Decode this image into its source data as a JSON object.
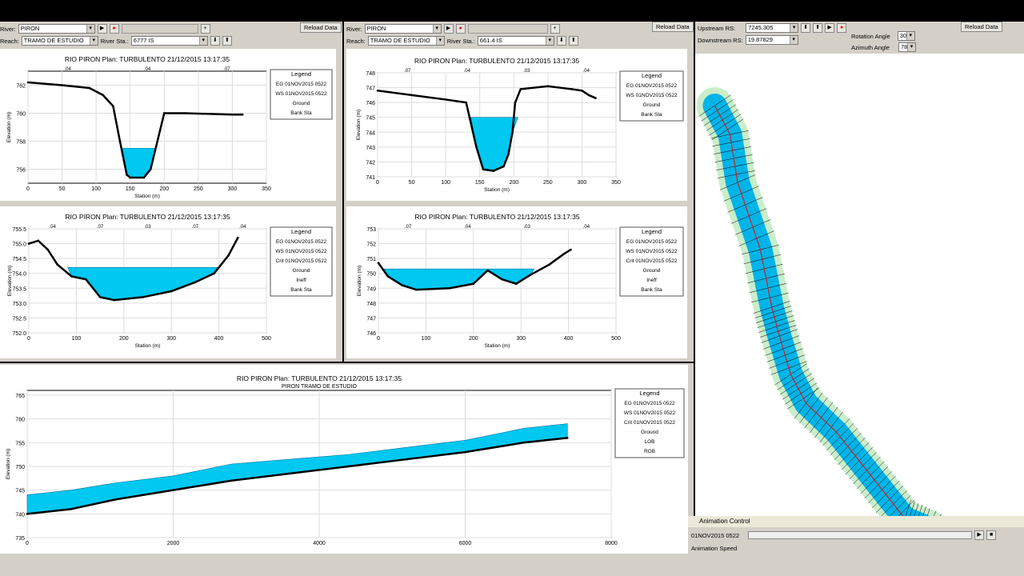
{
  "panel_left": {
    "river_label": "River:",
    "river": "PIRON",
    "reach_label": "Reach:",
    "reach": "TRAMO DE ESTUDIO",
    "rs_label": "River Sta.:",
    "rs": "6777  IS",
    "reload": "Reload Data"
  },
  "panel_mid": {
    "river_label": "River:",
    "river": "PIRON",
    "reach_label": "Reach:",
    "reach": "TRAMO DE ESTUDIO",
    "rs_label": "River Sta.:",
    "rs": "661.4  IS",
    "reload": "Reload Data"
  },
  "panel_right": {
    "up_label": "Upstream RS:",
    "up": "7245.305",
    "down_label": "Downstream RS:",
    "down": "19.87829",
    "rot_label": "Rotation Angle",
    "rot": "30",
    "az_label": "Azimuth Angle",
    "az": "78",
    "reload": "Reload Data"
  },
  "chart_data": [
    {
      "type": "line",
      "title": "RIO PIRON     Plan: TURBULENTO     21/12/2015    13:17:35",
      "xlabel": "Station (m)",
      "ylabel": "Elevation (m)",
      "xlim": [
        0,
        350
      ],
      "ylim": [
        755,
        763
      ],
      "xticks": [
        "0",
        "50",
        "100",
        "150",
        "200",
        "250",
        "300",
        "350"
      ],
      "yticks": [
        "756",
        "758",
        "760",
        "762"
      ],
      "mann": [
        ".04",
        ".04",
        ".07"
      ],
      "ground": [
        [
          0,
          762.2
        ],
        [
          50,
          762
        ],
        [
          90,
          761.8
        ],
        [
          110,
          761.3
        ],
        [
          125,
          760.5
        ],
        [
          135,
          758
        ],
        [
          145,
          755.6
        ],
        [
          150,
          755.4
        ],
        [
          170,
          755.4
        ],
        [
          180,
          756
        ],
        [
          190,
          758
        ],
        [
          200,
          760
        ],
        [
          230,
          760
        ],
        [
          300,
          759.9
        ],
        [
          315,
          759.9
        ]
      ],
      "ws": 757.5,
      "legend": [
        "EG 01NOV2015 0522",
        "WS 01NOV2015 0522",
        "Ground",
        "Bank Sta"
      ]
    },
    {
      "type": "line",
      "title": "RIO PIRON     Plan: TURBULENTO     21/12/2015    13:17:35",
      "xlabel": "Station (m)",
      "ylabel": "Elevation (m)",
      "xlim": [
        0,
        350
      ],
      "ylim": [
        741,
        748
      ],
      "xticks": [
        "0",
        "50",
        "100",
        "150",
        "200",
        "250",
        "300",
        "350"
      ],
      "yticks": [
        "741",
        "742",
        "743",
        "744",
        "745",
        "746",
        "747",
        "748"
      ],
      "mann": [
        ".07",
        ".04",
        ".03",
        ".04"
      ],
      "ground": [
        [
          0,
          746.8
        ],
        [
          50,
          746.5
        ],
        [
          100,
          746.2
        ],
        [
          130,
          746
        ],
        [
          135,
          745
        ],
        [
          145,
          743
        ],
        [
          155,
          741.5
        ],
        [
          170,
          741.4
        ],
        [
          185,
          741.7
        ],
        [
          192,
          742.5
        ],
        [
          198,
          744
        ],
        [
          202,
          746
        ],
        [
          210,
          746.9
        ],
        [
          250,
          747.1
        ],
        [
          285,
          746.9
        ],
        [
          300,
          746.8
        ],
        [
          310,
          746.5
        ],
        [
          320,
          746.3
        ]
      ],
      "ws": 745,
      "legend": [
        "EG 01NOV2015 0522",
        "WS 01NOV2015 0522",
        "Ground",
        "Bank Sta"
      ]
    },
    {
      "type": "line",
      "title": "RIO PIRON     Plan: TURBULENTO     21/12/2015    13:17:35",
      "xlabel": "Station (m)",
      "ylabel": "Elevation (m)",
      "xlim": [
        0,
        500
      ],
      "ylim": [
        752,
        755.5
      ],
      "xticks": [
        "0",
        "100",
        "200",
        "300",
        "400",
        "500"
      ],
      "yticks": [
        "752.0",
        "752.5",
        "753.0",
        "753.5",
        "754.0",
        "754.5",
        "755.0",
        "755.5"
      ],
      "mann": [
        ".04",
        ".07",
        ".03",
        ".07",
        ".04"
      ],
      "ground": [
        [
          0,
          755.0
        ],
        [
          20,
          755.1
        ],
        [
          40,
          754.8
        ],
        [
          60,
          754.3
        ],
        [
          90,
          753.9
        ],
        [
          120,
          753.8
        ],
        [
          150,
          753.2
        ],
        [
          180,
          753.1
        ],
        [
          240,
          753.2
        ],
        [
          300,
          753.4
        ],
        [
          350,
          753.7
        ],
        [
          390,
          754
        ],
        [
          420,
          754.6
        ],
        [
          440,
          755.2
        ]
      ],
      "ws": 754.2,
      "legend": [
        "EG 01NOV2015 0522",
        "WS 01NOV2015 0522",
        "Crit 01NOV2015 0522",
        "Ground",
        "Ineff",
        "Bank Sta"
      ]
    },
    {
      "type": "line",
      "title": "RIO PIRON     Plan: TURBULENTO     21/12/2015    13:17:35",
      "xlabel": "Station (m)",
      "ylabel": "Elevation (m)",
      "xlim": [
        0,
        500
      ],
      "ylim": [
        746,
        753
      ],
      "xticks": [
        "0",
        "100",
        "200",
        "300",
        "400",
        "500"
      ],
      "yticks": [
        "746",
        "747",
        "748",
        "749",
        "750",
        "751",
        "752",
        "753"
      ],
      "mann": [
        ".07",
        ".04",
        ".03",
        ".04"
      ],
      "ground": [
        [
          0,
          750.7
        ],
        [
          20,
          749.8
        ],
        [
          50,
          749.2
        ],
        [
          80,
          748.9
        ],
        [
          150,
          749.0
        ],
        [
          200,
          749.3
        ],
        [
          230,
          750.2
        ],
        [
          260,
          749.6
        ],
        [
          290,
          749.3
        ],
        [
          320,
          749.9
        ],
        [
          360,
          750.6
        ],
        [
          390,
          751.3
        ],
        [
          405,
          751.6
        ]
      ],
      "ws": 750.3,
      "legend": [
        "EG 01NOV2015 0522",
        "WS 01NOV2015 0522",
        "Crit 01NOV2015 0522",
        "Ground",
        "Ineff",
        "Bank Sta"
      ]
    },
    {
      "type": "line",
      "title": "RIO PIRON     Plan: TURBULENTO     21/12/2015    13:17:35",
      "subtitle": "PIRON TRAMO DE ESTUDIO",
      "xlabel": "",
      "ylabel": "Elevation (m)",
      "xlim": [
        0,
        8000
      ],
      "ylim": [
        735,
        766
      ],
      "xticks": [
        "0",
        "2000",
        "4000",
        "6000",
        "8000"
      ],
      "yticks": [
        "735",
        "740",
        "745",
        "750",
        "755",
        "760",
        "765"
      ],
      "ground": [
        [
          0,
          740
        ],
        [
          600,
          741
        ],
        [
          1200,
          743
        ],
        [
          2000,
          745
        ],
        [
          2800,
          747
        ],
        [
          3600,
          748.5
        ],
        [
          4400,
          750
        ],
        [
          5200,
          751.5
        ],
        [
          6000,
          753
        ],
        [
          6800,
          755
        ],
        [
          7400,
          756
        ]
      ],
      "ws": [
        [
          0,
          744
        ],
        [
          600,
          745
        ],
        [
          1200,
          746.5
        ],
        [
          2000,
          748
        ],
        [
          2800,
          750.5
        ],
        [
          3600,
          751.5
        ],
        [
          4400,
          752.5
        ],
        [
          5200,
          754
        ],
        [
          6000,
          755.5
        ],
        [
          6800,
          758
        ],
        [
          7400,
          759
        ]
      ],
      "legend": [
        "EG  01NOV2015 0522",
        "WS  01NOV2015 0522",
        "Crit  01NOV2015 0522",
        "Ground",
        "LOB",
        "ROB"
      ]
    }
  ],
  "map": {
    "river_points": [
      [
        10,
        0
      ],
      [
        30,
        30
      ],
      [
        40,
        80
      ],
      [
        70,
        150
      ],
      [
        85,
        210
      ],
      [
        95,
        240
      ],
      [
        110,
        280
      ],
      [
        130,
        310
      ],
      [
        170,
        340
      ],
      [
        200,
        370
      ],
      [
        230,
        400
      ],
      [
        260,
        430
      ],
      [
        290,
        440
      ],
      [
        330,
        460
      ],
      [
        390,
        470
      ]
    ]
  },
  "animation": {
    "title": "Animation Control",
    "profile": "01NOV2015 0522",
    "speed_label": "Animation Speed"
  },
  "colors": {
    "water": "#00c8f0",
    "ground": "#808080",
    "line": "#000000",
    "bank": "#ff0000",
    "bg": "#d4d0c8"
  }
}
